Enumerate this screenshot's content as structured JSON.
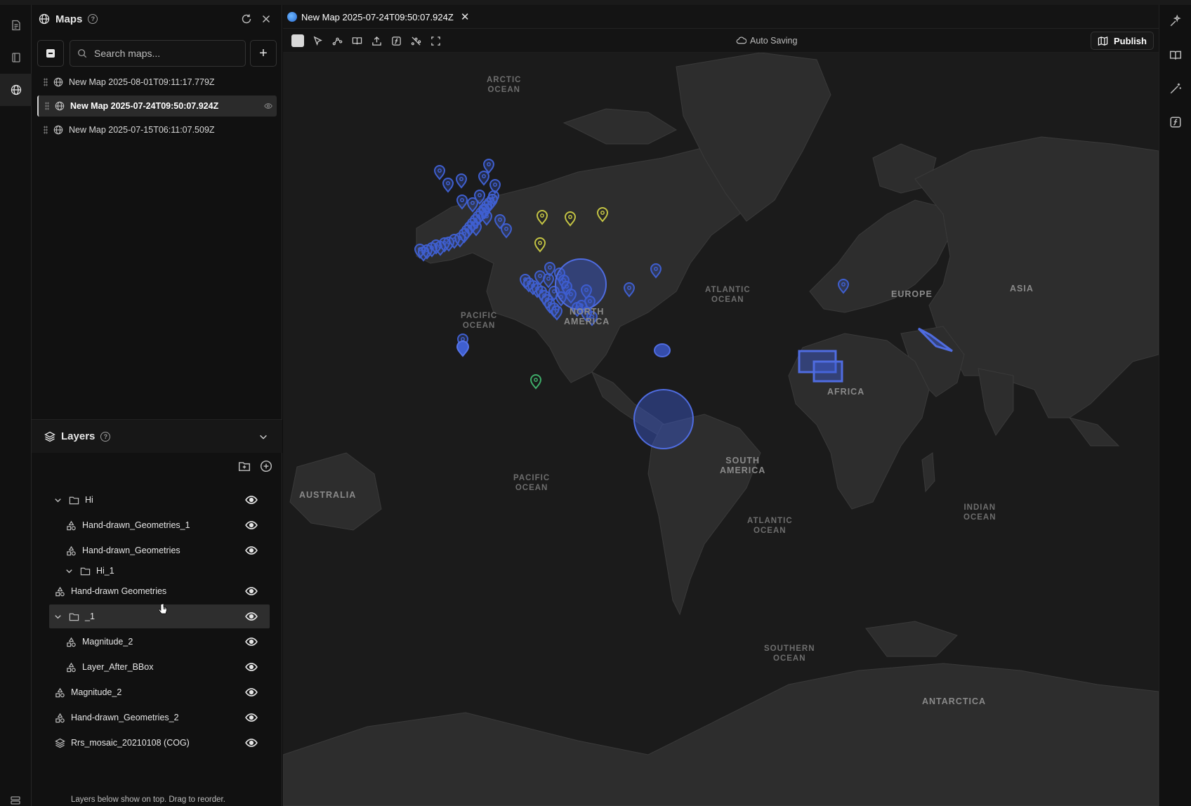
{
  "maps_panel": {
    "title": "Maps",
    "search_placeholder": "Search maps...",
    "items": [
      {
        "label": "New Map 2025-08-01T09:11:17.779Z"
      },
      {
        "label": "New Map 2025-07-24T09:50:07.924Z"
      },
      {
        "label": "New Map 2025-07-15T06:11:07.509Z"
      }
    ]
  },
  "layers_panel": {
    "title": "Layers",
    "rows": [
      {
        "label": "Hi"
      },
      {
        "label": "Hand-drawn_Geometries_1"
      },
      {
        "label": "Hand-drawn_Geometries"
      },
      {
        "label": "Hi_1"
      },
      {
        "label": "Hand-drawn Geometries"
      },
      {
        "label": "_1"
      },
      {
        "label": "Magnitude_2"
      },
      {
        "label": "Layer_After_BBox"
      },
      {
        "label": "Magnitude_2"
      },
      {
        "label": "Hand-drawn_Geometries_2"
      },
      {
        "label": "Rrs_mosaic_20210108 (COG)"
      }
    ],
    "footer_note": "Layers below show on top. Drag to reorder."
  },
  "tab": {
    "label": "New Map 2025-07-24T09:50:07.924Z"
  },
  "toolbar": {
    "autosave_label": "Auto Saving",
    "publish_label": "Publish"
  },
  "map_labels": {
    "arctic_ocean": "ARCTIC\nOCEAN",
    "pacific_ocean_n": "PACIFIC\nOCEAN",
    "pacific_ocean_s": "PACIFIC\nOCEAN",
    "atlantic_ocean_n": "ATLANTIC\nOCEAN",
    "atlantic_ocean_s": "ATLANTIC\nOCEAN",
    "indian_ocean": "INDIAN\nOCEAN",
    "southern_ocean": "SOUTHERN\nOCEAN",
    "north_america": "NORTH\nAMERICA",
    "south_america": "SOUTH\nAMERICA",
    "europe": "EUROPE",
    "asia": "ASIA",
    "africa": "AFRICA",
    "australia": "AUSTRALIA",
    "antarctica": "ANTARCTICA"
  },
  "colors": {
    "marker_blue": "#3f5fd0",
    "marker_yellow": "#c4c444",
    "marker_green": "#3fae6a",
    "polygon_fill": "#3c5ad0"
  }
}
